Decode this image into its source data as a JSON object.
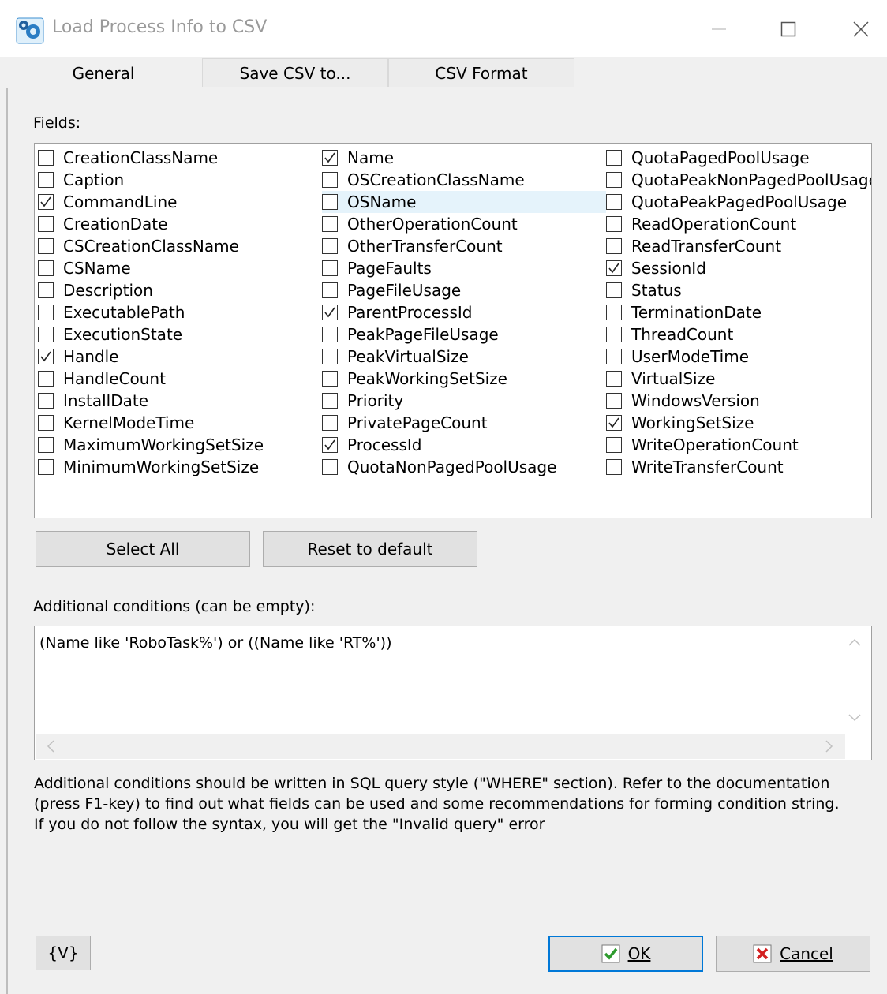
{
  "window": {
    "title": "Load Process Info to CSV"
  },
  "tabs": [
    {
      "label": "General",
      "active": true
    },
    {
      "label": "Save CSV to...",
      "active": false
    },
    {
      "label": "CSV Format",
      "active": false
    }
  ],
  "fields": {
    "label": "Fields:",
    "columns": [
      [
        {
          "name": "CreationClassName",
          "checked": false
        },
        {
          "name": "Caption",
          "checked": false
        },
        {
          "name": "CommandLine",
          "checked": true
        },
        {
          "name": "CreationDate",
          "checked": false
        },
        {
          "name": "CSCreationClassName",
          "checked": false
        },
        {
          "name": "CSName",
          "checked": false
        },
        {
          "name": "Description",
          "checked": false
        },
        {
          "name": "ExecutablePath",
          "checked": false
        },
        {
          "name": "ExecutionState",
          "checked": false
        },
        {
          "name": "Handle",
          "checked": true
        },
        {
          "name": "HandleCount",
          "checked": false
        },
        {
          "name": "InstallDate",
          "checked": false
        },
        {
          "name": "KernelModeTime",
          "checked": false
        },
        {
          "name": "MaximumWorkingSetSize",
          "checked": false
        },
        {
          "name": "MinimumWorkingSetSize",
          "checked": false
        }
      ],
      [
        {
          "name": "Name",
          "checked": true
        },
        {
          "name": "OSCreationClassName",
          "checked": false
        },
        {
          "name": "OSName",
          "checked": false,
          "highlighted": true
        },
        {
          "name": "OtherOperationCount",
          "checked": false
        },
        {
          "name": "OtherTransferCount",
          "checked": false
        },
        {
          "name": "PageFaults",
          "checked": false
        },
        {
          "name": "PageFileUsage",
          "checked": false
        },
        {
          "name": "ParentProcessId",
          "checked": true
        },
        {
          "name": "PeakPageFileUsage",
          "checked": false
        },
        {
          "name": "PeakVirtualSize",
          "checked": false
        },
        {
          "name": "PeakWorkingSetSize",
          "checked": false
        },
        {
          "name": "Priority",
          "checked": false
        },
        {
          "name": "PrivatePageCount",
          "checked": false
        },
        {
          "name": "ProcessId",
          "checked": true
        },
        {
          "name": "QuotaNonPagedPoolUsage",
          "checked": false
        }
      ],
      [
        {
          "name": "QuotaPagedPoolUsage",
          "checked": false
        },
        {
          "name": "QuotaPeakNonPagedPoolUsage",
          "checked": false
        },
        {
          "name": "QuotaPeakPagedPoolUsage",
          "checked": false
        },
        {
          "name": "ReadOperationCount",
          "checked": false
        },
        {
          "name": "ReadTransferCount",
          "checked": false
        },
        {
          "name": "SessionId",
          "checked": true
        },
        {
          "name": "Status",
          "checked": false
        },
        {
          "name": "TerminationDate",
          "checked": false
        },
        {
          "name": "ThreadCount",
          "checked": false
        },
        {
          "name": "UserModeTime",
          "checked": false
        },
        {
          "name": "VirtualSize",
          "checked": false
        },
        {
          "name": "WindowsVersion",
          "checked": false
        },
        {
          "name": "WorkingSetSize",
          "checked": true
        },
        {
          "name": "WriteOperationCount",
          "checked": false
        },
        {
          "name": "WriteTransferCount",
          "checked": false
        }
      ]
    ]
  },
  "buttons": {
    "select_all": "Select All",
    "reset": "Reset to default",
    "variables": "{V}",
    "ok": "OK",
    "cancel": "Cancel"
  },
  "conditions": {
    "label": "Additional conditions (can be empty):",
    "value": "(Name like 'RoboTask%') or ((Name like 'RT%'))"
  },
  "help_lines": [
    "Additional conditions should be written in SQL query style (\"WHERE\" section). Refer to the documentation",
    "(press F1-key) to find out what fields can be used and some recommendations for forming condition string.",
    "If you do not follow the syntax, you will get the \"Invalid query\" error"
  ],
  "icons": {
    "app": "gear-app-icon",
    "minimize": "minimize-icon",
    "maximize": "maximize-icon",
    "close": "close-icon",
    "ok": "check-icon",
    "cancel": "x-icon"
  },
  "colors": {
    "accent": "#0078d7",
    "ok_check": "#2e9b2e",
    "cancel_x": "#d32020"
  }
}
